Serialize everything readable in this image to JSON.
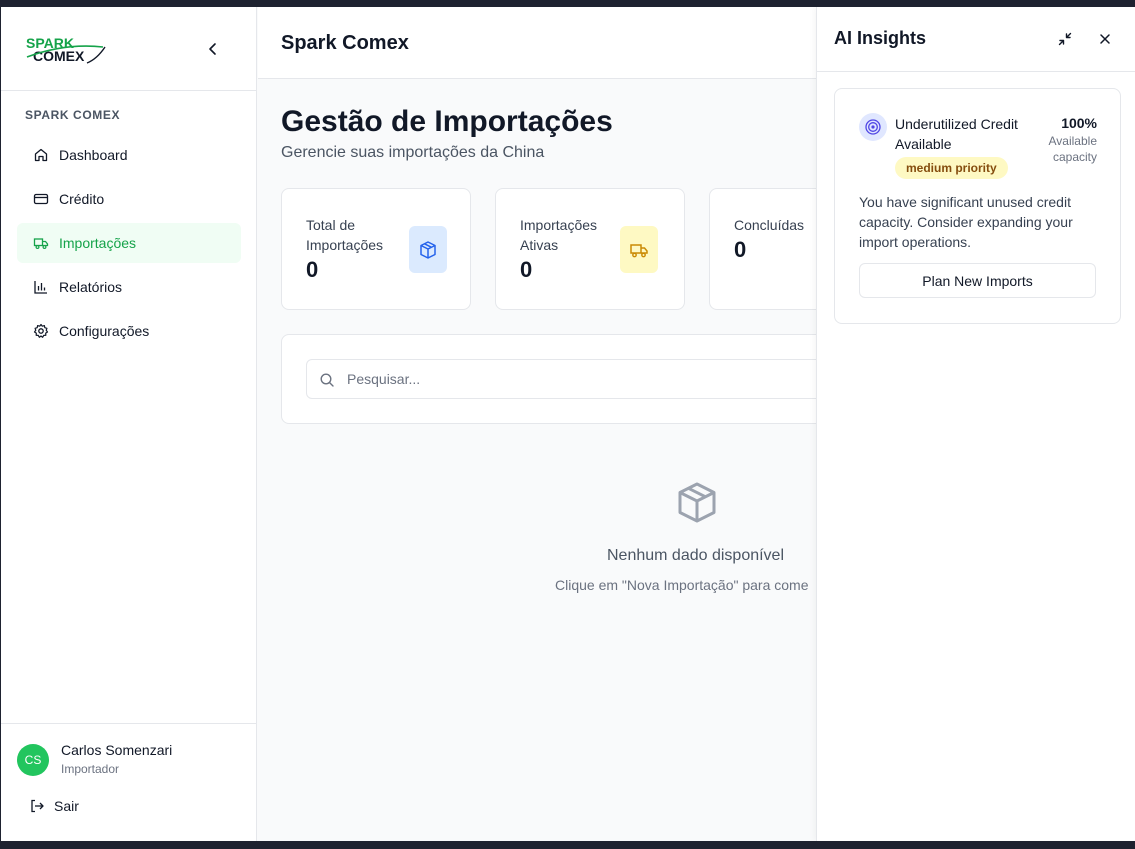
{
  "app": {
    "logo_top": "SPARK",
    "logo_bottom": "COMEX",
    "section_label": "SPARK COMEX"
  },
  "sidebar": {
    "items": [
      {
        "label": "Dashboard",
        "icon": "home-icon"
      },
      {
        "label": "Crédito",
        "icon": "credit-card-icon"
      },
      {
        "label": "Importações",
        "icon": "truck-icon",
        "active": true
      },
      {
        "label": "Relatórios",
        "icon": "bar-chart-icon"
      },
      {
        "label": "Configurações",
        "icon": "gear-icon"
      }
    ],
    "user": {
      "initials": "CS",
      "name": "Carlos Somenzari",
      "role": "Importador"
    },
    "logout_label": "Sair"
  },
  "header": {
    "title": "Spark Comex"
  },
  "main": {
    "title": "Gestão de Importações",
    "subtitle": "Gerencie suas importações da China",
    "stats": [
      {
        "label": "Total de Importações",
        "value": "0",
        "icon": "package-icon"
      },
      {
        "label": "Importações Ativas",
        "value": "0",
        "icon": "truck-icon"
      },
      {
        "label": "Concluídas",
        "value": "0"
      }
    ],
    "search": {
      "placeholder": "Pesquisar..."
    },
    "empty": {
      "title": "Nenhum dado disponível",
      "description": "Clique em \"Nova Importação\" para come"
    }
  },
  "ai_panel": {
    "title": "AI Insights",
    "insight": {
      "title": "Underutilized Credit Available",
      "priority": "medium priority",
      "percent": "100%",
      "percent_label": "Available capacity",
      "description": "You have significant unused credit capacity. Consider expanding your import operations.",
      "button": "Plan New Imports",
      "icon": "target-icon"
    }
  },
  "colors": {
    "accent": "#16a34a",
    "active_bg": "#f0fdf4",
    "package_bg": "#dbeafe",
    "truck_bg": "#fef9c3",
    "badge_bg": "#fef9c3"
  }
}
